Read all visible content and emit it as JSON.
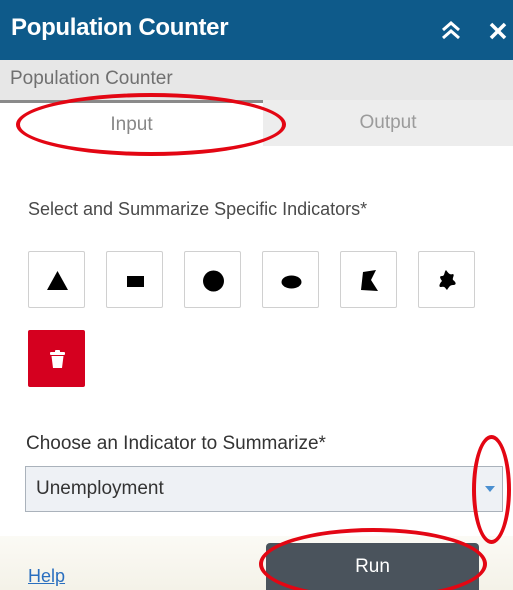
{
  "window": {
    "title": "Population Counter"
  },
  "subheader": {
    "label": "Population Counter"
  },
  "tabs": [
    {
      "label": "Input",
      "active": true
    },
    {
      "label": "Output",
      "active": false
    }
  ],
  "draw_tools": {
    "label": "Select and Summarize Specific Indicators*",
    "tools": [
      {
        "name": "triangle-icon"
      },
      {
        "name": "rectangle-icon"
      },
      {
        "name": "circle-icon"
      },
      {
        "name": "ellipse-icon"
      },
      {
        "name": "polygon-icon"
      },
      {
        "name": "freehand-polygon-icon"
      },
      {
        "name": "trash-icon"
      }
    ]
  },
  "indicator": {
    "label": "Choose an Indicator to Summarize*",
    "selected": "Unemployment"
  },
  "footer": {
    "help_label": "Help",
    "run_label": "Run"
  },
  "colors": {
    "titlebar": "#0e5a8a",
    "delete": "#d5001f",
    "run_button": "#4a535c",
    "annotation": "#e30613"
  }
}
